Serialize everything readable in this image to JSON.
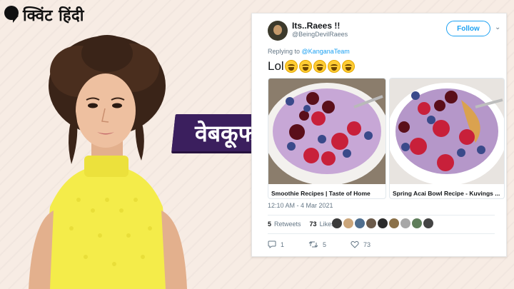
{
  "brand": {
    "name": "क्विंट हिंदी"
  },
  "badge": {
    "text": "वेबकूफ"
  },
  "tweet": {
    "display_name": "Its..Raees !!",
    "handle": "@BeingDevilRaees",
    "follow_label": "Follow",
    "reply_prefix": "Replying to",
    "reply_mention": "@KanganaTeam",
    "text": "Lol",
    "emoji_count": 5,
    "cards": [
      {
        "caption": "Smoothie Recipes | Taste of Home"
      },
      {
        "caption": "Spring Acai Bowl Recipe - Kuvings ..."
      }
    ],
    "timestamp": "12:10 AM - 4 Mar 2021",
    "retweets_count": "5",
    "retweets_label": "Retweets",
    "likes_count": "73",
    "likes_label": "Likes",
    "reply_count": "1",
    "retweet_count": "5",
    "like_count": "73"
  },
  "colors": {
    "background": "#f7ece4",
    "badge": "#3b1f5e",
    "twitter_blue": "#1da1f2",
    "dress": "#f4ec4a"
  },
  "icons": [
    "quint-logo-icon",
    "chevron-down-icon",
    "reply-icon",
    "retweet-icon",
    "heart-icon"
  ]
}
